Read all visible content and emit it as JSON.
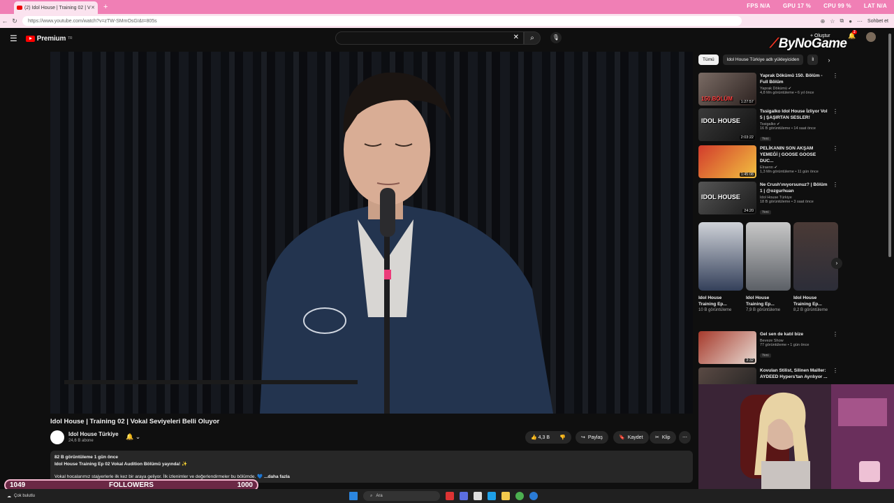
{
  "browser": {
    "tab_title": "(2) Idol House | Training 02 | V",
    "new_tab": "+",
    "url": "https://www.youtube.com/watch?v=zTW-SMmOsGI&t=805s",
    "chat_label": "Sohbet et",
    "perf": {
      "fps_label": "FPS",
      "fps_value": "N/A",
      "gpu_label": "GPU",
      "gpu_value": "17 %",
      "cpu_label": "CPU",
      "cpu_value": "99 %",
      "lat_label": "LAT",
      "lat_value": "N/A"
    }
  },
  "header": {
    "logo_text": "Premium",
    "logo_sup": "TR",
    "search_clear": "✕",
    "create_label": "Oluştur",
    "notif_count": "2",
    "overlay_brand_a": "By",
    "overlay_brand_b": "NoGame"
  },
  "video": {
    "title": "Idol House | Training 02 | Vokal Seviyeleri Belli Oluyor",
    "channel": "Idol House Türkiye",
    "subscribers": "24,6 B abone",
    "likes": "4,3 B",
    "share": "Paylaş",
    "save": "Kaydet",
    "clip": "Klip",
    "description": {
      "meta": "82 B görüntüleme  1 gün önce",
      "line1": "Idol House Training Ep 02 Vokal Audition Bölümü yayında! ✨",
      "line2": "Vokal hocalarımız stajyerlerle ilk kez bir araya geliyor. İlk izlenimler ve değerlendirmeler bu bölümde. 💙",
      "more": "...daha fazla"
    }
  },
  "sidebar": {
    "chips": [
      "Tümü",
      "Idol House Türkiye adlı yükleyiciden",
      "İl"
    ],
    "related": [
      {
        "title": "Yaprak Dökümü 150. Bölüm - Full Bölüm",
        "channel": "Yaprak Dökümü ✔",
        "meta": "4,8 Mn görüntüleme • 6 yıl önce",
        "duration": "1:27:57",
        "thumb_text": "150.BÖLÜM",
        "new": ""
      },
      {
        "title": "Tssigalko Idol House İzliyor Vol 5 | ŞAŞIRTAN SESLER!",
        "channel": "Tssigalko ✔",
        "meta": "16 B görüntüleme • 14 saat önce",
        "duration": "2:03:22",
        "thumb_text": "IDOL HOUSE",
        "new": "Yeni"
      },
      {
        "title": "PELİKANIN SON AKŞAM YEMEĞİ | GOOSE GOOSE DUC...",
        "channel": "Elraenn ✔",
        "meta": "1,3 Mn görüntüleme • 11 gün önce",
        "duration": "1:45:08",
        "thumb_text": "",
        "new": ""
      },
      {
        "title": "Ne Crush'ınıyorsunuz? | Bölüm 1 | @ozgurhuan",
        "channel": "Idol House Türkiye",
        "meta": "18 B görüntüleme • 3 saat önce",
        "duration": "24:20",
        "thumb_text": "IDOL HOUSE",
        "new": "Yeni"
      },
      {
        "title": "Gel sen de katıl bize",
        "channel": "Beveze Show",
        "meta": "77 görüntüleme • 1 gün önce",
        "duration": "3:32",
        "thumb_text": "",
        "new": "Yeni"
      },
      {
        "title": "Kovulan Stilist, Silinen Mailler: AYDEED Hypers'tan Ayrılıyor ...",
        "channel": "",
        "meta": "",
        "duration": "",
        "thumb_text": "",
        "new": ""
      }
    ],
    "shorts": [
      {
        "title": "Idol House Training Ep...",
        "views": "10 B görüntüleme"
      },
      {
        "title": "Idol House Training Ep...",
        "views": "7,9 B görüntüleme"
      },
      {
        "title": "Idol House Training Ep...",
        "views": "8,2 B görüntüleme"
      }
    ]
  },
  "followers": {
    "left": "1049",
    "label": "FOLLOWERS",
    "right": "1000",
    "progress": 1.0
  },
  "taskbar": {
    "weather": "Çok bulutlu",
    "search": "Ara"
  }
}
